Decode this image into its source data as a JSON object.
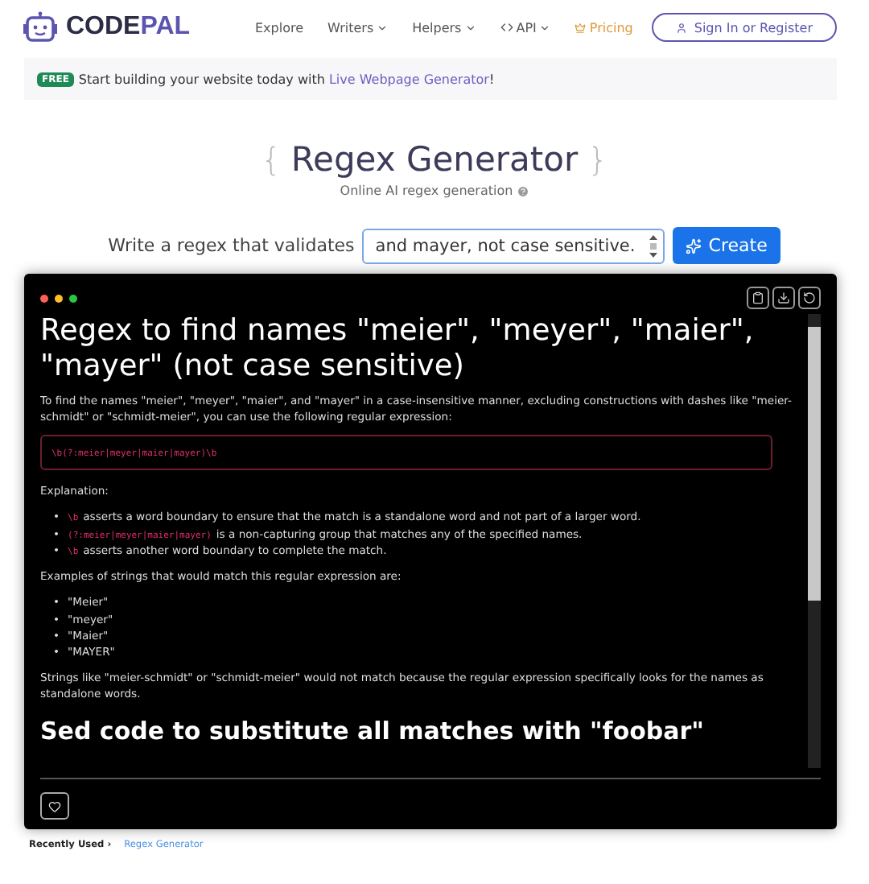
{
  "header": {
    "logo": [
      "CODE",
      "PAL"
    ],
    "nav": [
      {
        "label": "Explore",
        "kind": "link"
      },
      {
        "label": "Writers",
        "kind": "dropdown"
      },
      {
        "label": "Helpers",
        "kind": "dropdown"
      },
      {
        "label": "API",
        "kind": "api"
      },
      {
        "label": "Pricing",
        "kind": "pricing"
      }
    ],
    "sign_in": "Sign In or Register"
  },
  "banner": {
    "badge": "FREE",
    "text": "Start building your website today with",
    "link": "Live Webpage Generator",
    "end": "!"
  },
  "title": {
    "open": "{",
    "text": "Regex Generator",
    "close": "}"
  },
  "subtitle": "Online AI regex generation",
  "prompt": {
    "label": "Write a regex that validates",
    "value": "and mayer, not case sensitive.",
    "button": "Create"
  },
  "result": {
    "heading": "Regex to find names \"meier\", \"meyer\", \"maier\", \"mayer\" (not case sensitive)",
    "intro": "To find the names \"meier\", \"meyer\", \"maier\", and \"mayer\" in a case-insensitive manner, excluding constructions with dashes like \"meier-schmidt\" or \"schmidt-meier\", you can use the following regular expression:",
    "code": "\\b(?:meier|meyer|maier|mayer)\\b",
    "bullet": "•",
    "explanation_label": "Explanation:",
    "explanation": [
      {
        "code": "\\b",
        "text": "asserts a word boundary to ensure that the match is a standalone word and not part of a larger word."
      },
      {
        "code": "(?:meier|meyer|maier|mayer)",
        "text": "is a non-capturing group that matches any of the specified names."
      },
      {
        "code": "\\b",
        "text": "asserts another word boundary to complete the match."
      }
    ],
    "examples_label": "Examples of strings that would match this regular expression are:",
    "examples": [
      "\"Meier\"",
      "\"meyer\"",
      "\"Maier\"",
      "\"MAYER\""
    ],
    "note": "Strings like \"meier-schmidt\" or \"schmidt-meier\" would not match because the regular expression specifically looks for the names as standalone words.",
    "next_heading": "Sed code to substitute all matches with \"foobar\""
  },
  "footer": {
    "label": "Recently Used ›",
    "link": "Regex Generator"
  }
}
